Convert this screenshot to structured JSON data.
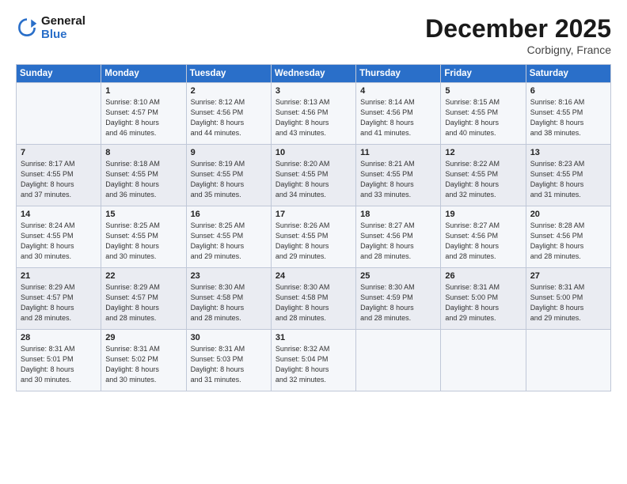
{
  "logo": {
    "line1": "General",
    "line2": "Blue"
  },
  "title": "December 2025",
  "location": "Corbigny, France",
  "days_of_week": [
    "Sunday",
    "Monday",
    "Tuesday",
    "Wednesday",
    "Thursday",
    "Friday",
    "Saturday"
  ],
  "weeks": [
    [
      {
        "day": "",
        "info": ""
      },
      {
        "day": "1",
        "info": "Sunrise: 8:10 AM\nSunset: 4:57 PM\nDaylight: 8 hours\nand 46 minutes."
      },
      {
        "day": "2",
        "info": "Sunrise: 8:12 AM\nSunset: 4:56 PM\nDaylight: 8 hours\nand 44 minutes."
      },
      {
        "day": "3",
        "info": "Sunrise: 8:13 AM\nSunset: 4:56 PM\nDaylight: 8 hours\nand 43 minutes."
      },
      {
        "day": "4",
        "info": "Sunrise: 8:14 AM\nSunset: 4:56 PM\nDaylight: 8 hours\nand 41 minutes."
      },
      {
        "day": "5",
        "info": "Sunrise: 8:15 AM\nSunset: 4:55 PM\nDaylight: 8 hours\nand 40 minutes."
      },
      {
        "day": "6",
        "info": "Sunrise: 8:16 AM\nSunset: 4:55 PM\nDaylight: 8 hours\nand 38 minutes."
      }
    ],
    [
      {
        "day": "7",
        "info": "Sunrise: 8:17 AM\nSunset: 4:55 PM\nDaylight: 8 hours\nand 37 minutes."
      },
      {
        "day": "8",
        "info": "Sunrise: 8:18 AM\nSunset: 4:55 PM\nDaylight: 8 hours\nand 36 minutes."
      },
      {
        "day": "9",
        "info": "Sunrise: 8:19 AM\nSunset: 4:55 PM\nDaylight: 8 hours\nand 35 minutes."
      },
      {
        "day": "10",
        "info": "Sunrise: 8:20 AM\nSunset: 4:55 PM\nDaylight: 8 hours\nand 34 minutes."
      },
      {
        "day": "11",
        "info": "Sunrise: 8:21 AM\nSunset: 4:55 PM\nDaylight: 8 hours\nand 33 minutes."
      },
      {
        "day": "12",
        "info": "Sunrise: 8:22 AM\nSunset: 4:55 PM\nDaylight: 8 hours\nand 32 minutes."
      },
      {
        "day": "13",
        "info": "Sunrise: 8:23 AM\nSunset: 4:55 PM\nDaylight: 8 hours\nand 31 minutes."
      }
    ],
    [
      {
        "day": "14",
        "info": "Sunrise: 8:24 AM\nSunset: 4:55 PM\nDaylight: 8 hours\nand 30 minutes."
      },
      {
        "day": "15",
        "info": "Sunrise: 8:25 AM\nSunset: 4:55 PM\nDaylight: 8 hours\nand 30 minutes."
      },
      {
        "day": "16",
        "info": "Sunrise: 8:25 AM\nSunset: 4:55 PM\nDaylight: 8 hours\nand 29 minutes."
      },
      {
        "day": "17",
        "info": "Sunrise: 8:26 AM\nSunset: 4:55 PM\nDaylight: 8 hours\nand 29 minutes."
      },
      {
        "day": "18",
        "info": "Sunrise: 8:27 AM\nSunset: 4:56 PM\nDaylight: 8 hours\nand 28 minutes."
      },
      {
        "day": "19",
        "info": "Sunrise: 8:27 AM\nSunset: 4:56 PM\nDaylight: 8 hours\nand 28 minutes."
      },
      {
        "day": "20",
        "info": "Sunrise: 8:28 AM\nSunset: 4:56 PM\nDaylight: 8 hours\nand 28 minutes."
      }
    ],
    [
      {
        "day": "21",
        "info": "Sunrise: 8:29 AM\nSunset: 4:57 PM\nDaylight: 8 hours\nand 28 minutes."
      },
      {
        "day": "22",
        "info": "Sunrise: 8:29 AM\nSunset: 4:57 PM\nDaylight: 8 hours\nand 28 minutes."
      },
      {
        "day": "23",
        "info": "Sunrise: 8:30 AM\nSunset: 4:58 PM\nDaylight: 8 hours\nand 28 minutes."
      },
      {
        "day": "24",
        "info": "Sunrise: 8:30 AM\nSunset: 4:58 PM\nDaylight: 8 hours\nand 28 minutes."
      },
      {
        "day": "25",
        "info": "Sunrise: 8:30 AM\nSunset: 4:59 PM\nDaylight: 8 hours\nand 28 minutes."
      },
      {
        "day": "26",
        "info": "Sunrise: 8:31 AM\nSunset: 5:00 PM\nDaylight: 8 hours\nand 29 minutes."
      },
      {
        "day": "27",
        "info": "Sunrise: 8:31 AM\nSunset: 5:00 PM\nDaylight: 8 hours\nand 29 minutes."
      }
    ],
    [
      {
        "day": "28",
        "info": "Sunrise: 8:31 AM\nSunset: 5:01 PM\nDaylight: 8 hours\nand 30 minutes."
      },
      {
        "day": "29",
        "info": "Sunrise: 8:31 AM\nSunset: 5:02 PM\nDaylight: 8 hours\nand 30 minutes."
      },
      {
        "day": "30",
        "info": "Sunrise: 8:31 AM\nSunset: 5:03 PM\nDaylight: 8 hours\nand 31 minutes."
      },
      {
        "day": "31",
        "info": "Sunrise: 8:32 AM\nSunset: 5:04 PM\nDaylight: 8 hours\nand 32 minutes."
      },
      {
        "day": "",
        "info": ""
      },
      {
        "day": "",
        "info": ""
      },
      {
        "day": "",
        "info": ""
      }
    ]
  ]
}
